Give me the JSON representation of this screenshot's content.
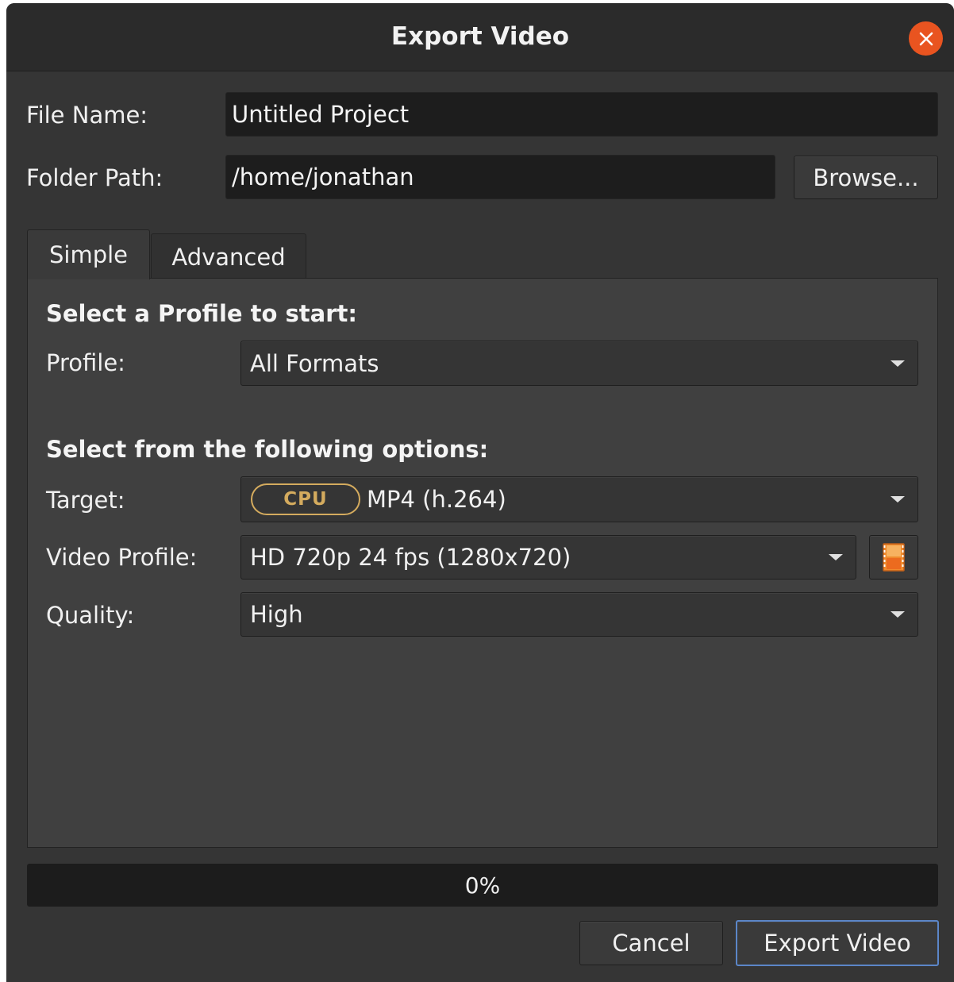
{
  "window": {
    "title": "Export Video"
  },
  "file_name": {
    "label": "File Name:",
    "value": "Untitled Project"
  },
  "folder_path": {
    "label": "Folder Path:",
    "value": "/home/jonathan",
    "browse_label": "Browse..."
  },
  "tabs": [
    {
      "label": "Simple",
      "active": true
    },
    {
      "label": "Advanced",
      "active": false
    }
  ],
  "simple": {
    "profile_heading": "Select a Profile to start:",
    "profile_label": "Profile:",
    "profile_value": "All Formats",
    "options_heading": "Select from the following options:",
    "target_label": "Target:",
    "target_badge": "CPU",
    "target_value": "MP4 (h.264)",
    "video_profile_label": "Video Profile:",
    "video_profile_value": "HD 720p 24 fps (1280x720)",
    "quality_label": "Quality:",
    "quality_value": "High"
  },
  "progress": {
    "value": 0,
    "text": "0%"
  },
  "buttons": {
    "cancel": "Cancel",
    "export": "Export Video"
  },
  "colors": {
    "close_button": "#e95420",
    "cpu_badge": "#d4ab5e",
    "export_border": "#5b86c8"
  },
  "icons": {
    "close": "close-icon",
    "dropdown": "chevron-down-icon",
    "profile_editor": "film-strip-icon"
  }
}
